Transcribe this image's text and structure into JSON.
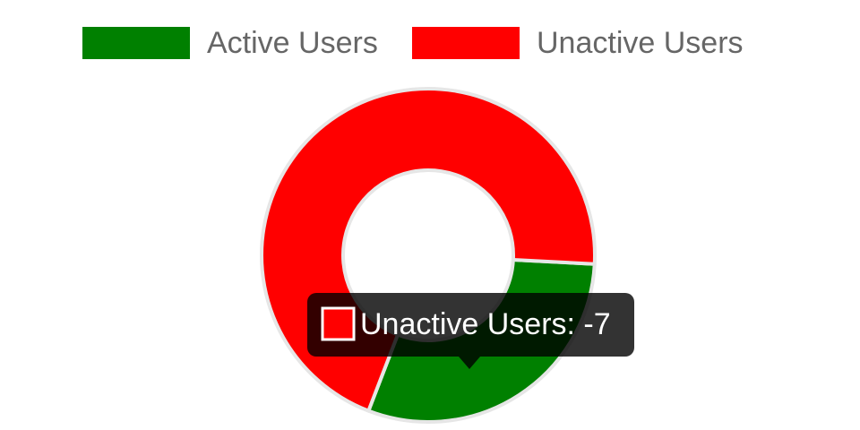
{
  "chart_data": {
    "type": "doughnut",
    "categories": [
      "Active Users",
      "Unactive Users"
    ],
    "series": [
      {
        "values": [
          3,
          7
        ],
        "colors": [
          "#008000",
          "#ff0000"
        ]
      }
    ],
    "legend_position": "top",
    "segment_border_color": "#e6e6e6"
  },
  "tooltip": {
    "label": "Unactive Users",
    "value": "-7",
    "text": "Unactive Users: -7",
    "swatch_color": "#ff0000",
    "background": "#000000"
  },
  "legend": [
    {
      "label": "Active Users",
      "color": "#008000"
    },
    {
      "label": "Unactive Users",
      "color": "#ff0000"
    }
  ]
}
